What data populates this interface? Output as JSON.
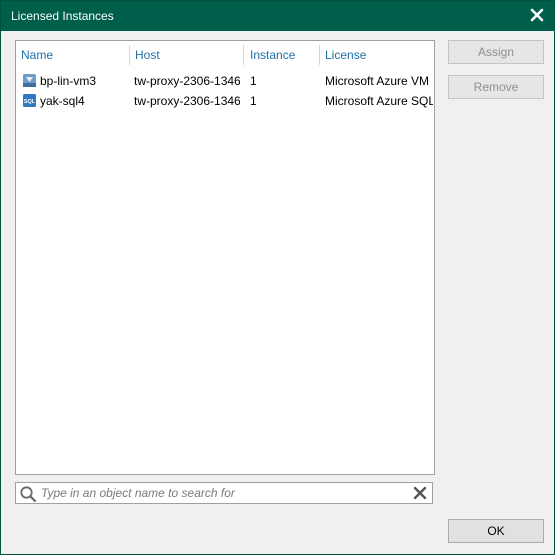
{
  "window": {
    "title": "Licensed Instances"
  },
  "table": {
    "columns": [
      "Name",
      "Host",
      "Instance",
      "License"
    ],
    "rows": [
      {
        "icon": "azure-vm-icon",
        "name": "bp-lin-vm3",
        "host": "tw-proxy-2306-1346",
        "instance": "1",
        "license": "Microsoft Azure VM"
      },
      {
        "icon": "sql-database-icon",
        "name": "yak-sql4",
        "host": "tw-proxy-2306-1346",
        "instance": "1",
        "license": "Microsoft Azure SQL"
      }
    ]
  },
  "buttons": {
    "assign": "Assign",
    "remove": "Remove",
    "ok": "OK"
  },
  "search": {
    "placeholder": "Type in an object name to search for",
    "value": ""
  },
  "colors": {
    "titlebar": "#005f4b",
    "header_text": "#1f6fa8"
  }
}
